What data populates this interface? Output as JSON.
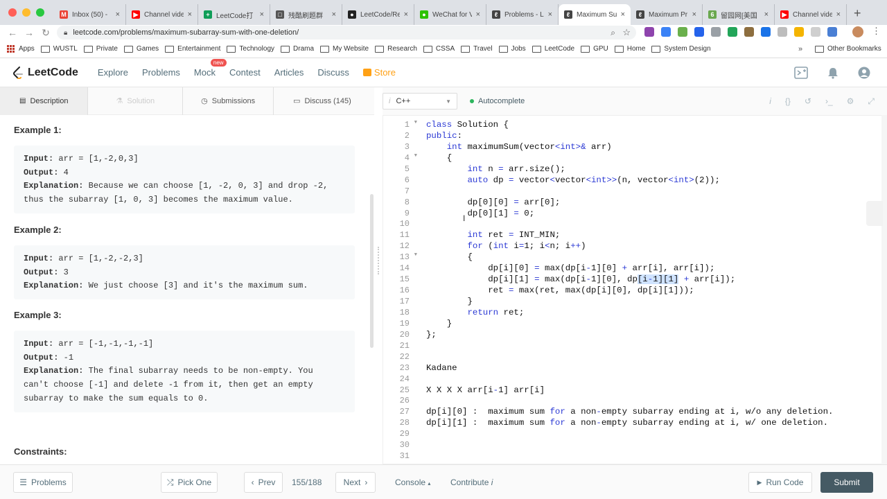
{
  "browser": {
    "tabs": [
      {
        "title": "Inbox (50) -",
        "fav_color": "#ea4335",
        "fav_text": "M",
        "active": false
      },
      {
        "title": "Channel vide",
        "fav_color": "#ff0000",
        "fav_text": "▶",
        "active": false
      },
      {
        "title": "LeetCode打",
        "fav_color": "#0f9d58",
        "fav_text": "+",
        "active": false
      },
      {
        "title": "残酷刷题群",
        "fav_color": "#555555",
        "fav_text": "□",
        "active": false
      },
      {
        "title": "LeetCode/Re",
        "fav_color": "#222222",
        "fav_text": "●",
        "active": false
      },
      {
        "title": "WeChat for V",
        "fav_color": "#2dc100",
        "fav_text": "●",
        "active": false
      },
      {
        "title": "Problems - L",
        "fav_color": "#444444",
        "fav_text": "ℓ",
        "active": false
      },
      {
        "title": "Maximum Su",
        "fav_color": "#444444",
        "fav_text": "ℓ",
        "active": true
      },
      {
        "title": "Maximum Pr",
        "fav_color": "#444444",
        "fav_text": "ℓ",
        "active": false
      },
      {
        "title": "留园网[美国",
        "fav_color": "#6aa84f",
        "fav_text": "6",
        "active": false
      },
      {
        "title": "Channel vide",
        "fav_color": "#ff0000",
        "fav_text": "▶",
        "active": false
      }
    ],
    "new_tab": "+",
    "url": "leetcode.com/problems/maximum-subarray-sum-with-one-deletion/",
    "bookmarks": [
      "Apps",
      "WUSTL",
      "Private",
      "Games",
      "Entertainment",
      "Technology",
      "Drama",
      "My Website",
      "Research",
      "CSSA",
      "Travel",
      "Jobs",
      "LeetCode",
      "GPU",
      "Home",
      "System Design"
    ],
    "bookmarks_more": "»",
    "other_bookmarks": "Other Bookmarks"
  },
  "nav": {
    "logo": "LeetCode",
    "links": [
      "Explore",
      "Problems",
      "Mock",
      "Contest",
      "Articles",
      "Discuss"
    ],
    "new_badge": "new",
    "store": "Store"
  },
  "desc_tabs": [
    {
      "label": "Description",
      "icon": "doc-icon"
    },
    {
      "label": "Solution",
      "icon": "flask-icon"
    },
    {
      "label": "Submissions",
      "icon": "clock-icon"
    },
    {
      "label": "Discuss (145)",
      "icon": "chat-icon"
    }
  ],
  "examples": [
    {
      "title": "Example 1:",
      "input_label": "Input:",
      "input": " arr = [1,-2,0,3]",
      "output_label": "Output:",
      "output": " 4",
      "expl_label": "Explanation:",
      "expl1": " Because we can choose [1, -2, 0, 3] and drop -2,",
      "expl2": "thus the subarray [1, 0, 3] becomes the maximum value.",
      "expl3": ""
    },
    {
      "title": "Example 2:",
      "input_label": "Input:",
      "input": " arr = [1,-2,-2,3]",
      "output_label": "Output:",
      "output": " 3",
      "expl_label": "Explanation:",
      "expl1": " We just choose [3] and it's the maximum sum.",
      "expl2": "",
      "expl3": ""
    },
    {
      "title": "Example 3:",
      "input_label": "Input:",
      "input": " arr = [-1,-1,-1,-1]",
      "output_label": "Output:",
      "output": " -1",
      "expl_label": "Explanation:",
      "expl1": " The final subarray needs to be non-empty. You",
      "expl2": "can't choose [-1] and delete -1 from it, then get an empty",
      "expl3": "subarray to make the sum equals to 0."
    }
  ],
  "constraints_title": "Constraints:",
  "editor": {
    "language": "C++",
    "autocomplete": "Autocomplete",
    "fold_lines": [
      1,
      4,
      13
    ]
  },
  "bottom": {
    "problems": "Problems",
    "pick_one": "Pick One",
    "prev": "Prev",
    "counter": "155/188",
    "next": "Next",
    "console": "Console",
    "contribute": "Contribute",
    "run_code": "Run Code",
    "submit": "Submit"
  }
}
